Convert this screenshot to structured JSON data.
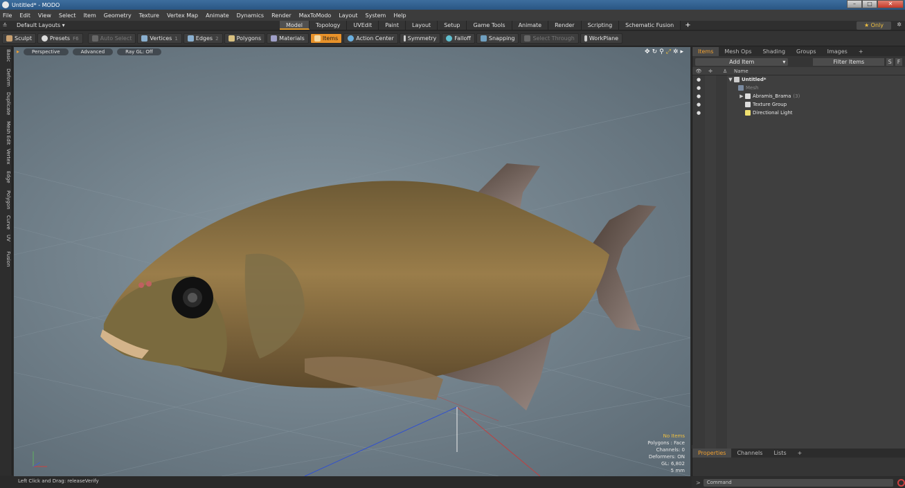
{
  "window": {
    "title": "Untitled* - MODO",
    "min": "–",
    "max": "□",
    "close": "✕"
  },
  "menu": [
    "File",
    "Edit",
    "View",
    "Select",
    "Item",
    "Geometry",
    "Texture",
    "Vertex Map",
    "Animate",
    "Dynamics",
    "Render",
    "MaxToModo",
    "Layout",
    "System",
    "Help"
  ],
  "layout": {
    "pin": "≛",
    "name": "Default Layouts ▾",
    "tabs": [
      "Model",
      "Topology",
      "UVEdit",
      "Paint",
      "Layout",
      "Setup",
      "Game Tools",
      "Animate",
      "Render",
      "Scripting",
      "Schematic Fusion"
    ],
    "active_tab": "Model",
    "plus": "+",
    "only": "★ Only",
    "gear": "✲"
  },
  "toolbar": {
    "sculpt": "Sculpt",
    "presets": "Presets",
    "presets_key": "F6",
    "auto_select": "Auto Select",
    "vertices": "Vertices",
    "vertices_key": "1",
    "edges": "Edges",
    "edges_key": "2",
    "polygons": "Polygons",
    "materials": "Materials",
    "items": "Items",
    "action_center": "Action Center",
    "symmetry": "Symmetry",
    "falloff": "Falloff",
    "snapping": "Snapping",
    "select_through": "Select Through",
    "workplane": "WorkPlane"
  },
  "left_tabs": [
    "Basic",
    "Deform",
    "Duplicate",
    "Mesh Edit",
    "Vertex",
    "Edge",
    "Polygon",
    "Curve",
    "UV",
    "Fusion"
  ],
  "viewport": {
    "perspective": "Perspective",
    "advanced": "Advanced",
    "raygl": "Ray GL: Off",
    "info": {
      "items": "No Items",
      "polygons": "Polygons : Face",
      "channels": "Channels: 0",
      "deformers": "Deformers: ON",
      "gl": "GL: 6,802",
      "scale": "5 mm"
    }
  },
  "status": "Left Click and Drag:  releaseVerify",
  "right_panel": {
    "tabs": [
      "Items",
      "Mesh Ops",
      "Shading",
      "Groups",
      "Images"
    ],
    "active_tab": "Items",
    "plus": "+",
    "add_item": "Add Item",
    "filter": "Filter Items",
    "s": "S",
    "f": "F",
    "name_header": "Name",
    "tree": [
      {
        "label": "Untitled*",
        "style": "bold",
        "arrow": "▼"
      },
      {
        "label": "Mesh",
        "style": "dim",
        "arrow": ""
      },
      {
        "label": "Abramis_Brama",
        "count": "(3)",
        "style": "",
        "arrow": "▶"
      },
      {
        "label": "Texture Group",
        "style": "",
        "arrow": ""
      },
      {
        "label": "Directional Light",
        "style": "",
        "arrow": ""
      }
    ]
  },
  "properties_panel": {
    "tabs": [
      "Properties",
      "Channels",
      "Lists"
    ],
    "active_tab": "Properties",
    "plus": "+"
  },
  "command": {
    "placeholder": "Command",
    "prompt": ">"
  }
}
